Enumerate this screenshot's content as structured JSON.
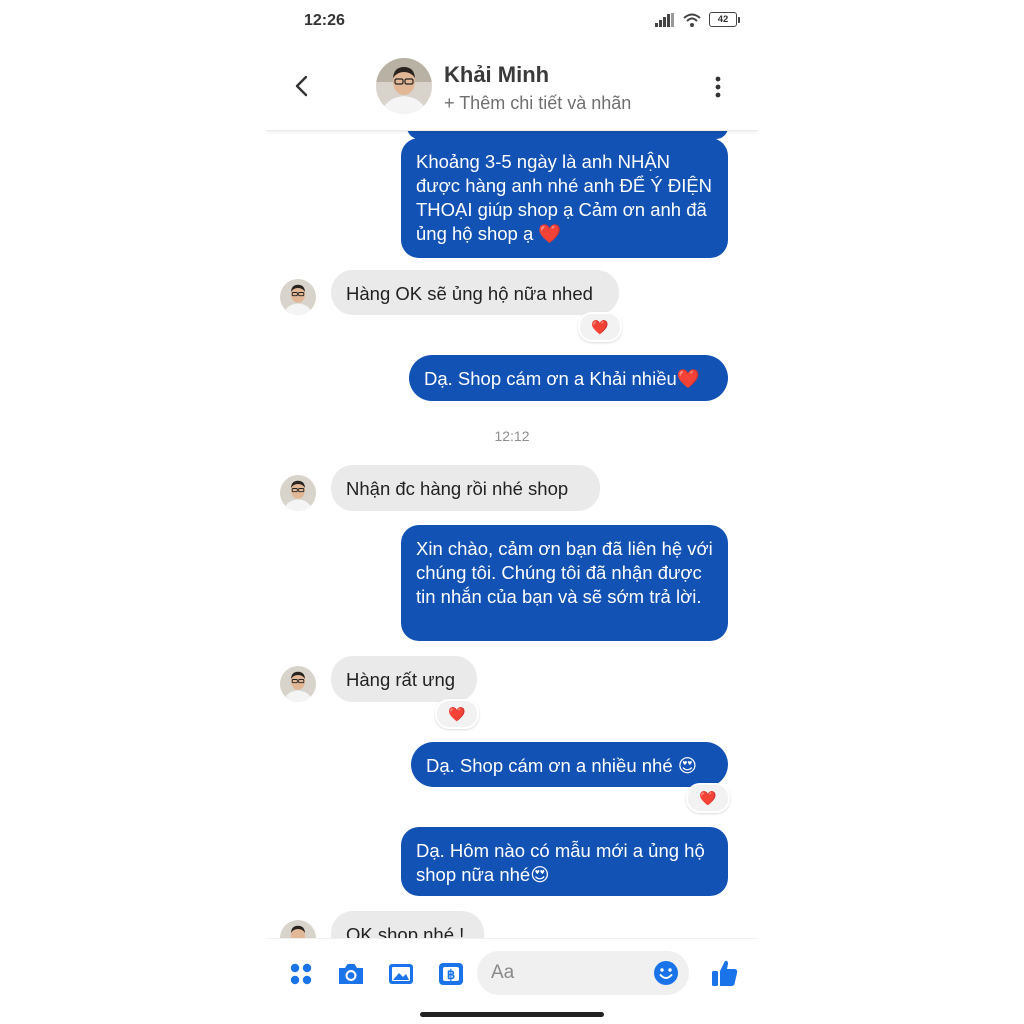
{
  "status_bar": {
    "time": "12:26",
    "battery": "42"
  },
  "header": {
    "contact_name": "Khải Minh",
    "subtitle": "+ Thêm chi tiết và nhãn"
  },
  "messages": [
    {
      "from": "me",
      "text": "Khoảng 3-5 ngày là anh NHẬN được hàng anh nhé anh ĐỂ Ý ĐIỆN THOẠI giúp shop ạ Cảm ơn anh đã ủng hộ shop ạ ❤️"
    },
    {
      "from": "them",
      "text": "Hàng OK sẽ ủng hộ nữa nhed",
      "reaction": "❤️"
    },
    {
      "from": "me",
      "text": "Dạ. Shop cám ơn a Khải nhiều❤️"
    },
    {
      "timestamp": "12:12"
    },
    {
      "from": "them",
      "text": "Nhận đc hàng rồi nhé shop"
    },
    {
      "from": "me",
      "text": "Xin chào, cảm ơn bạn đã liên hệ với chúng tôi. Chúng tôi đã nhận được tin nhắn của bạn và sẽ sớm trả lời."
    },
    {
      "from": "them",
      "text": "Hàng rất ưng",
      "reaction": "❤️"
    },
    {
      "from": "me",
      "text": "Dạ. Shop cám ơn a nhiều nhé 😍",
      "reaction": "❤️"
    },
    {
      "from": "me",
      "text": "Dạ. Hôm nào có mẫu mới a ủng hộ shop nữa nhé😍"
    },
    {
      "from": "them",
      "text": "OK shop nhé !"
    }
  ],
  "composer": {
    "placeholder": "Aa",
    "icons": [
      "menu-grid-icon",
      "camera-icon",
      "gallery-icon",
      "payment-icon",
      "emoji-icon",
      "like-icon"
    ]
  },
  "colors": {
    "accent": "#1252b5",
    "incoming_bubble": "#eaeaea",
    "icon_blue": "#1a73e8",
    "heart": "#e0182d"
  }
}
